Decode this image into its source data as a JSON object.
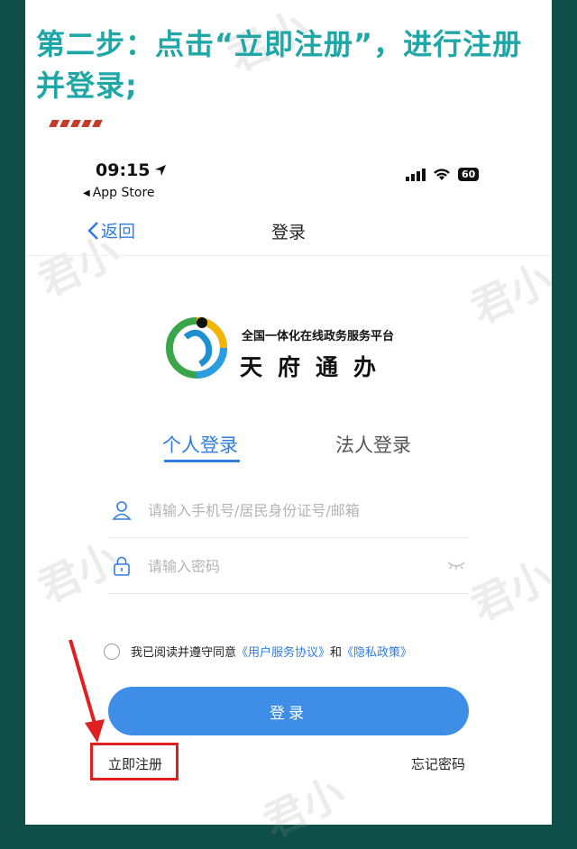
{
  "instruction": {
    "line1": "第二步：点击“立即注册”，进行注册",
    "line2": "并登录;"
  },
  "status_bar": {
    "time": "09:15",
    "back_app": "App Store",
    "battery": "60"
  },
  "nav": {
    "back_label": "返回",
    "title": "登录"
  },
  "brand": {
    "subtitle": "全国一体化在线政务服务平台",
    "name": "天府通办"
  },
  "tabs": [
    {
      "label": "个人登录",
      "active": true
    },
    {
      "label": "法人登录",
      "active": false
    }
  ],
  "form": {
    "account_placeholder": "请输入手机号/居民身份证号/邮箱",
    "account_value": "",
    "password_placeholder": "请输入密码",
    "password_value": ""
  },
  "agreement": {
    "prefix": "我已阅读并遵守同意",
    "user_agreement": "《用户服务协议》",
    "and": "和",
    "privacy_policy": "《隐私政策》"
  },
  "buttons": {
    "login": "登录",
    "register": "立即注册",
    "forgot": "忘记密码"
  },
  "colors": {
    "accent": "#2f7de1",
    "headline": "#1fa7a7",
    "highlight": "#e02020",
    "background": "#0f4f4a"
  }
}
